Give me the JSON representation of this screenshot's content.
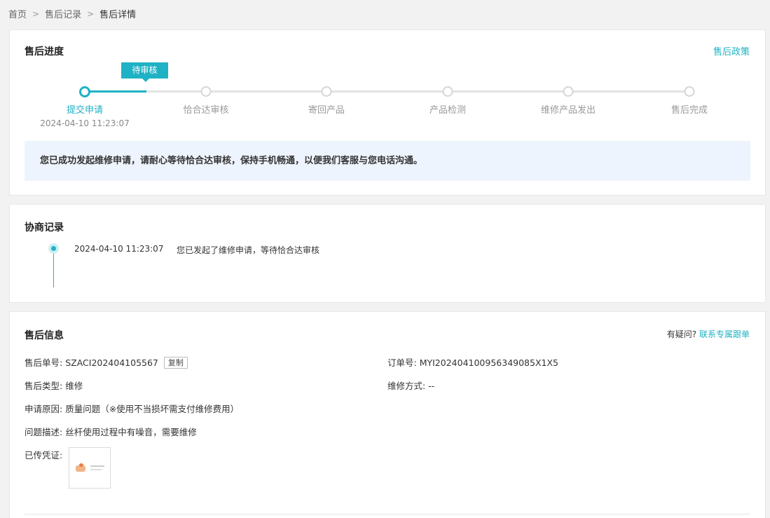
{
  "breadcrumb": {
    "home": "首页",
    "records": "售后记录",
    "current": "售后详情",
    "sep": ">"
  },
  "progress": {
    "title": "售后进度",
    "policy_link": "售后政策",
    "status_tag": "待审核",
    "steps": [
      "提交申请",
      "恰合达审核",
      "寄回产品",
      "产品检测",
      "维修产品发出",
      "售后完成"
    ],
    "active_step": 0,
    "submit_time": "2024-04-10 11:23:07",
    "notice": "您已成功发起维修申请，请耐心等待恰合达审核，保持手机畅通，以便我们客服与您电话沟通。"
  },
  "negotiation": {
    "title": "协商记录",
    "records": [
      {
        "time": "2024-04-10 11:23:07",
        "text": "您已发起了维修申请，等待恰合达审核"
      }
    ]
  },
  "info": {
    "title": "售后信息",
    "help_question": "有疑问?",
    "help_link": "联系专属跟单",
    "service_no_label": "售后单号:",
    "service_no": "SZACI202404105567",
    "copy_label": "复制",
    "order_no_label": "订单号:",
    "order_no": "MYI202404100956349085X1X5",
    "type_label": "售后类型:",
    "type": "维修",
    "repair_method_label": "维修方式:",
    "repair_method": "--",
    "reason_label": "申请原因:",
    "reason": "质量问题（※使用不当损坏需支付维修费用）",
    "desc_label": "问题描述:",
    "desc": "丝杆使用过程中有噪音，需要维修",
    "evidence_label": "已传凭证:"
  },
  "colors": {
    "accent": "#1fb2c4",
    "notice_bg": "#eef4fd",
    "page_bg": "#f2f2f2"
  }
}
